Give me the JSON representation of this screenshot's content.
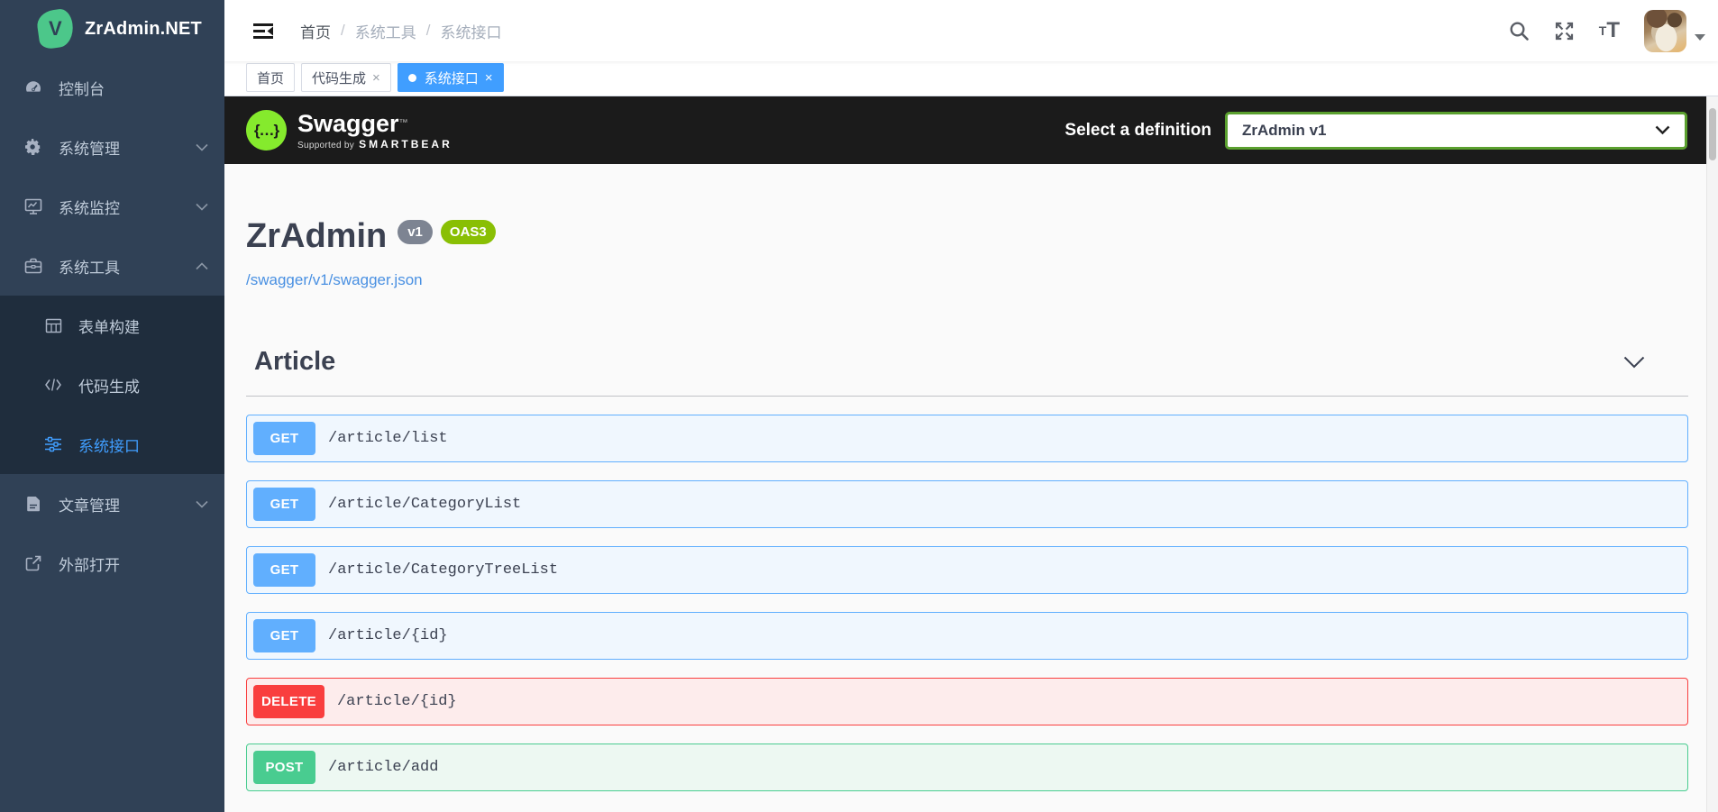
{
  "colors": {
    "sidebar_bg": "#304156",
    "submenu_bg": "#1f2d3d",
    "accent_blue": "#409eff",
    "logo_green": "#4cc78a",
    "swagger_bar_bg": "#1b1b1b",
    "swagger_logo_green": "#85ea2d",
    "select_border_green": "#5ba02f",
    "method_get": "#61affe",
    "method_delete": "#f93e3e",
    "method_post": "#49cc90",
    "oas_badge_green": "#89bf04",
    "version_badge_gray": "#7d8492",
    "link_blue": "#4990e2",
    "title_gray": "#3b4151"
  },
  "sidebar": {
    "logo_letter": "V",
    "logo_text": "ZrAdmin.NET",
    "items": [
      {
        "label": "控制台",
        "icon": "dashboard-icon"
      },
      {
        "label": "系统管理",
        "icon": "gear-icon",
        "chevron": "down"
      },
      {
        "label": "系统监控",
        "icon": "monitor-icon",
        "chevron": "down"
      },
      {
        "label": "系统工具",
        "icon": "toolbox-icon",
        "chevron": "up"
      },
      {
        "label": "表单构建",
        "icon": "table-icon"
      },
      {
        "label": "代码生成",
        "icon": "code-icon"
      },
      {
        "label": "系统接口",
        "icon": "sliders-icon"
      },
      {
        "label": "文章管理",
        "icon": "document-icon",
        "chevron": "down"
      },
      {
        "label": "外部打开",
        "icon": "external-link-icon"
      }
    ]
  },
  "navbar": {
    "breadcrumb": [
      {
        "label": "首页"
      },
      {
        "label": "系统工具"
      },
      {
        "label": "系统接口"
      }
    ],
    "breadcrumb_separator": "/",
    "icons": [
      "search-icon",
      "fullscreen-icon",
      "font-size-icon"
    ],
    "font_icon_small": "T",
    "font_icon_large": "T"
  },
  "tabs_bar": {
    "close_glyph": "×",
    "tabs": [
      {
        "label": "首页",
        "closable": false,
        "active": false
      },
      {
        "label": "代码生成",
        "closable": true,
        "active": false
      },
      {
        "label": "系统接口",
        "closable": true,
        "active": true
      }
    ]
  },
  "swagger": {
    "brand": "Swagger",
    "brand_tm": "™",
    "brand_glyph": "{…}",
    "supported_by": "Supported by",
    "smartbear": "SMARTBEAR",
    "select_label": "Select a definition",
    "selected_definition": "ZrAdmin v1",
    "title": "ZrAdmin",
    "version_badge": "v1",
    "oas_badge": "OAS3",
    "spec_url": "/swagger/v1/swagger.json",
    "section": {
      "title": "Article"
    },
    "endpoints": [
      {
        "method": "GET",
        "path": "/article/list"
      },
      {
        "method": "GET",
        "path": "/article/CategoryList"
      },
      {
        "method": "GET",
        "path": "/article/CategoryTreeList"
      },
      {
        "method": "GET",
        "path": "/article/{id}"
      },
      {
        "method": "DELETE",
        "path": "/article/{id}"
      },
      {
        "method": "POST",
        "path": "/article/add"
      }
    ]
  }
}
